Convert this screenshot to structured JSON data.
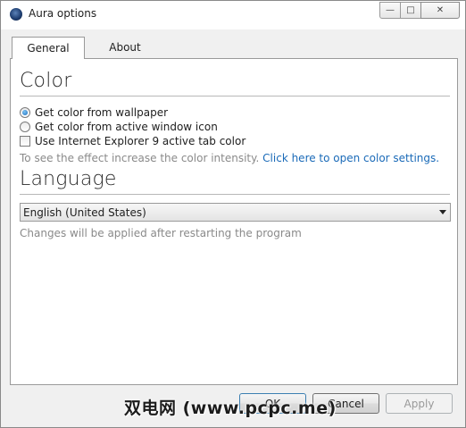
{
  "window": {
    "title": "Aura options",
    "controls": {
      "minimize": "—",
      "maximize": "□",
      "close": "✕"
    }
  },
  "tabs": [
    {
      "label": "General",
      "active": true
    },
    {
      "label": "About",
      "active": false
    }
  ],
  "color_section": {
    "title": "Color",
    "options": [
      {
        "label": "Get color from wallpaper",
        "type": "radio",
        "checked": true
      },
      {
        "label": "Get color from active window icon",
        "type": "radio",
        "checked": false
      },
      {
        "label": "Use Internet Explorer 9 active tab color",
        "type": "checkbox",
        "checked": false
      }
    ],
    "hint": "To see the effect increase the color intensity.",
    "link": "Click here to open color settings."
  },
  "language_section": {
    "title": "Language",
    "selected": "English (United States)",
    "hint": "Changes will be applied after restarting the program"
  },
  "buttons": {
    "ok": "OK",
    "cancel": "Cancel",
    "apply": "Apply"
  },
  "watermark": "双电网 (www.pcpc.me)"
}
